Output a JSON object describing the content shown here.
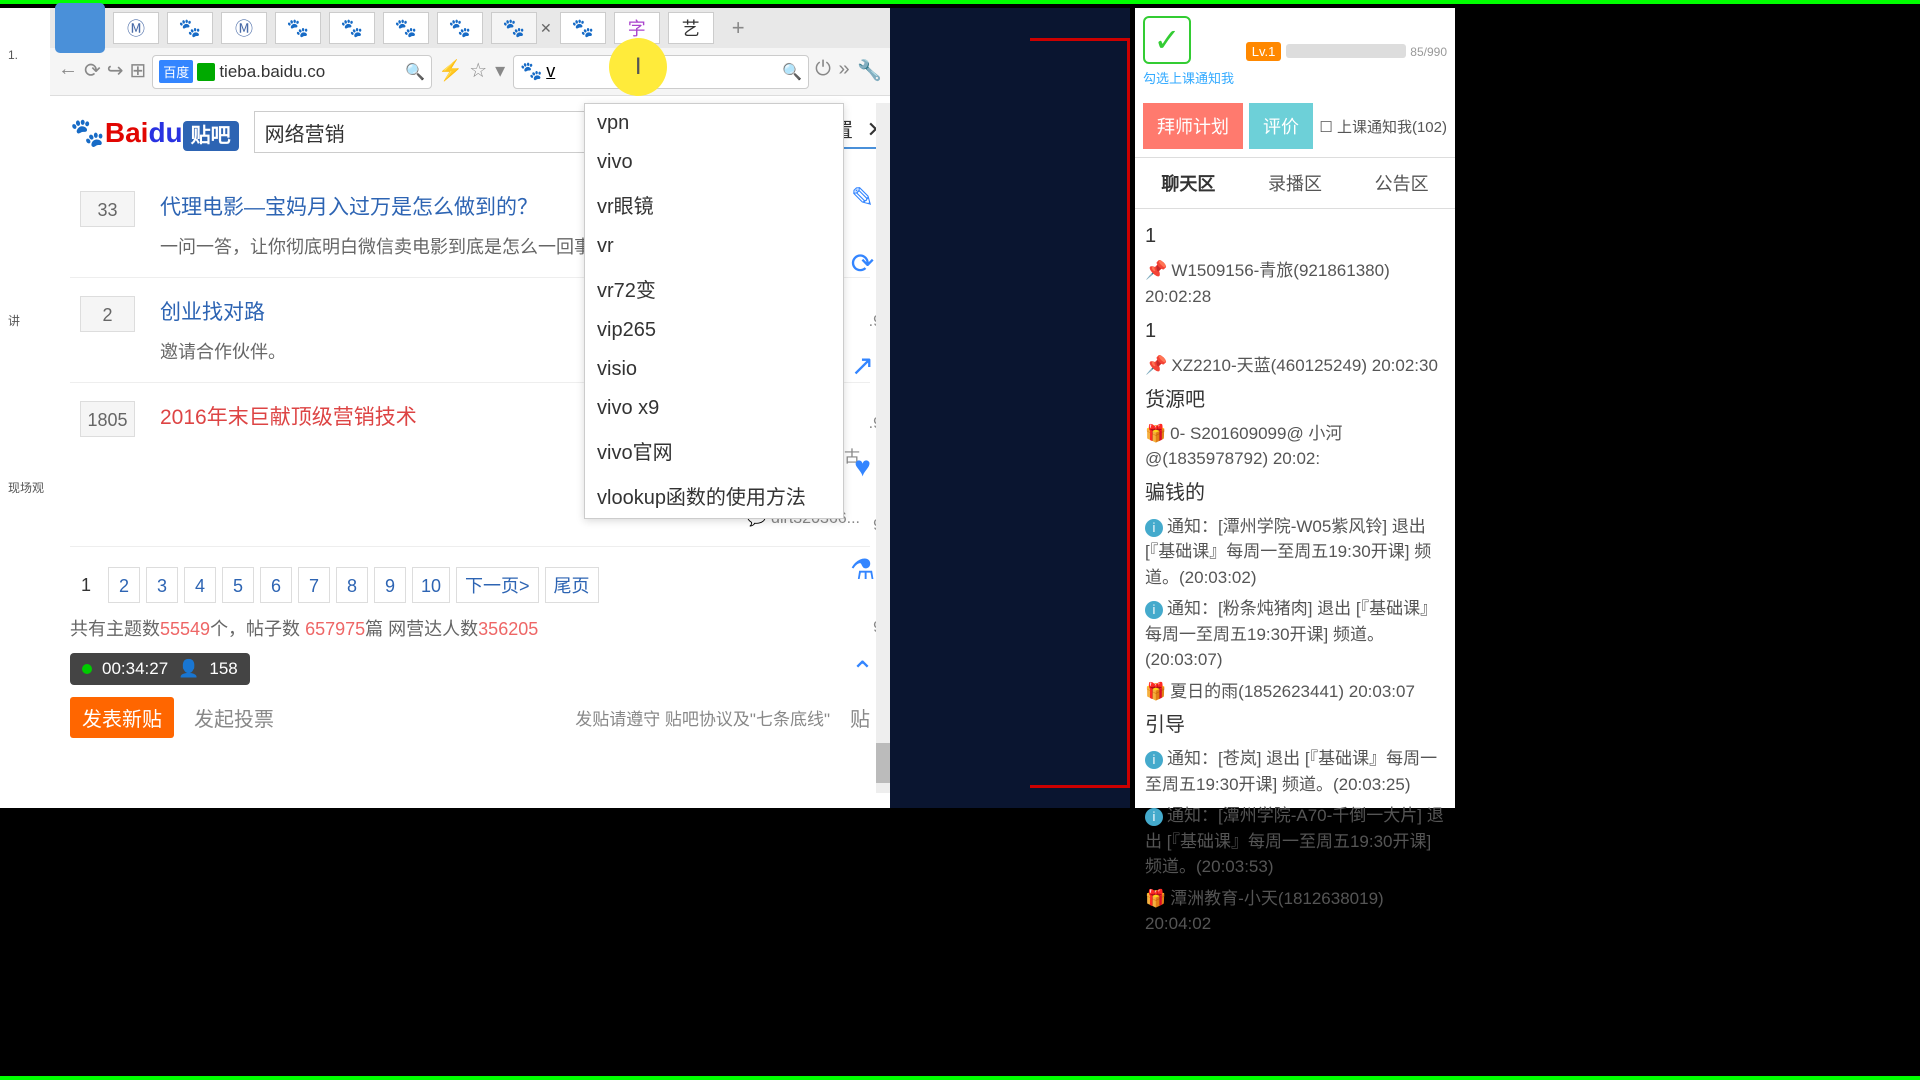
{
  "tabs": {
    "new_tab": "+"
  },
  "toolbar": {
    "addr_label": "百度",
    "url": "tieba.baidu.co",
    "search_value": "v"
  },
  "dropdown": {
    "items": [
      "vpn",
      "vivo",
      "vr眼镜",
      "vr",
      "vr72变",
      "vip265",
      "visio",
      "vivo x9",
      "vivo官网",
      "vlookup函数的使用方法"
    ]
  },
  "page": {
    "logo_bai": "Bai",
    "logo_du": "du",
    "logo_tieba": "贴吧",
    "search_value": "网络营销",
    "settings": "设置",
    "close_x": "✕"
  },
  "posts": [
    {
      "num": "33",
      "title": "代理电影—宝妈月入过万是怎么做到的？",
      "desc": "一问一答，让你彻底明白微信卖电影到底是怎么一回事!!"
    },
    {
      "num": "2",
      "title": "创业找对路",
      "desc": "邀请合作伙伴。"
    },
    {
      "num": "1805",
      "title": "2016年末巨献顶级营销技术",
      "user": "坚古",
      "comment": "dirt320366..."
    }
  ],
  "side_nums": [
    ".9",
    ".9",
    "9",
    "9"
  ],
  "pager": {
    "pages": [
      "1",
      "2",
      "3",
      "4",
      "5",
      "6",
      "7",
      "8",
      "9",
      "10"
    ],
    "next": "下一页>",
    "last": "尾页"
  },
  "stats": {
    "t1": "共有主题数",
    "n1": "55549",
    "t2": "个，帖子数 ",
    "n2": "657975",
    "t3": "篇 网营达人数",
    "n3": "356205"
  },
  "timer": {
    "time": "00:34:27",
    "count": "158"
  },
  "bottom": {
    "new_post": "发表新贴",
    "vote": "发起投票",
    "note": "发贴请遵守 贴吧协议及\"七条底线\"",
    "tie": "贴"
  },
  "left_side": {
    "n1": "1.",
    "t1": "讲",
    "t2": "现场观"
  },
  "right": {
    "sub": "勾选上课通知我",
    "lv": "Lv.1",
    "progress": "85/990",
    "btn1": "拜师计划",
    "btn2": "评价",
    "notify": "上课通知我(102)",
    "tabs": [
      "聊天区",
      "录播区",
      "公告区"
    ],
    "chat": [
      {
        "type": "num",
        "text": "1"
      },
      {
        "type": "pin",
        "text": "W1509156-青旅(921861380) 20:02:28"
      },
      {
        "type": "num",
        "text": "1"
      },
      {
        "type": "pin",
        "text": "XZ2210-天蓝(460125249) 20:02:30"
      },
      {
        "type": "bold",
        "text": "货源吧"
      },
      {
        "type": "gift",
        "text": "0- S201609099@ 小河@(1835978792) 20:02:"
      },
      {
        "type": "bold",
        "text": "骗钱的"
      },
      {
        "type": "info",
        "text": "通知：[潭州学院-W05紫风铃] 退出 [『基础课』每周一至周五19:30开课] 频道。(20:03:02)"
      },
      {
        "type": "info",
        "text": "通知：[粉条炖猪肉] 退出 [『基础课』每周一至周五19:30开课] 频道。(20:03:07)"
      },
      {
        "type": "gift",
        "text": "夏日的雨(1852623441) 20:03:07"
      },
      {
        "type": "bold",
        "text": "引导"
      },
      {
        "type": "info",
        "text": "通知：[苍岚] 退出 [『基础课』每周一至周五19:30开课] 频道。(20:03:25)"
      },
      {
        "type": "info",
        "text": "通知：[潭州学院-A70-千倒一大片] 退出 [『基础课』每周一至周五19:30开课] 频道。(20:03:53)"
      },
      {
        "type": "gift",
        "text": "潭洲教育-小天(1812638019) 20:04:02"
      }
    ]
  }
}
